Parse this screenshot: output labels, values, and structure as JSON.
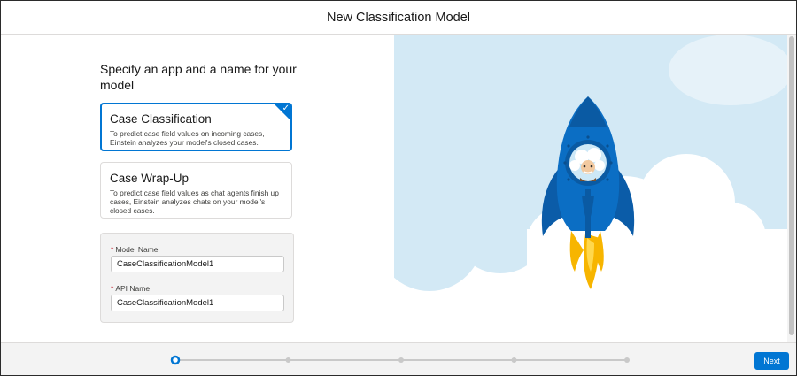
{
  "header": {
    "title": "New Classification Model"
  },
  "main": {
    "heading": "Specify an app and a name for your model",
    "apps": [
      {
        "title": "Case Classification",
        "description": "To predict case field values on incoming cases, Einstein analyzes your model's closed cases.",
        "selected": true
      },
      {
        "title": "Case Wrap-Up",
        "description": "To predict case field values as chat agents finish up cases, Einstein analyzes chats on your model's closed cases.",
        "selected": false
      }
    ],
    "form": {
      "required_marker": "*",
      "model_name_label": "Model Name",
      "model_name_value": "CaseClassificationModel1",
      "api_name_label": "API Name",
      "api_name_value": "CaseClassificationModel1"
    }
  },
  "footer": {
    "progress": {
      "total_steps": 5,
      "current_step": 1
    },
    "next_label": "Next"
  },
  "colors": {
    "brand": "#0176d3",
    "sky": "#cfe6f3",
    "rocket": "#0b6ec4",
    "flame": "#f7b500"
  },
  "icons": [
    "check-icon",
    "einstein-rocket-illustration",
    "cloud-illustration"
  ]
}
